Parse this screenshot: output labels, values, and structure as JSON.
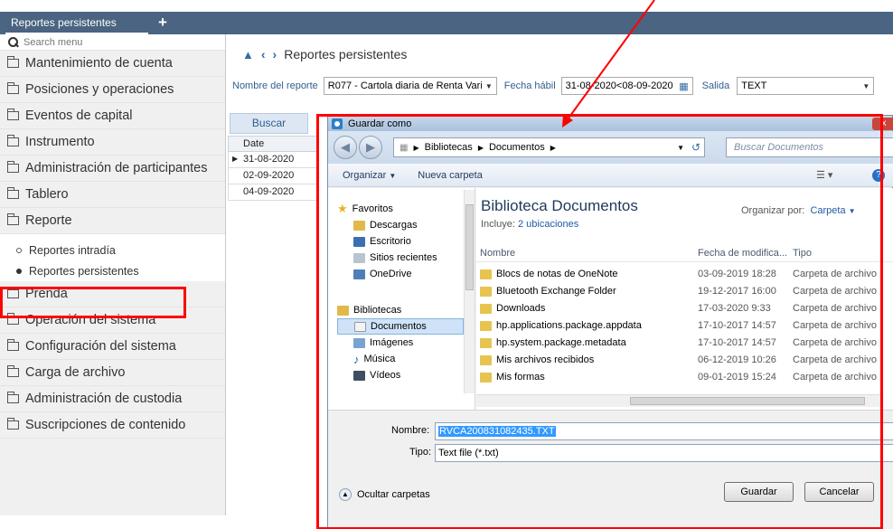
{
  "top_tab": {
    "label": "Reportes persistentes",
    "plus": "+"
  },
  "sidebar": {
    "search_placeholder": "Search menu",
    "items": [
      {
        "label": "Mantenimiento de cuenta"
      },
      {
        "label": "Posiciones y operaciones"
      },
      {
        "label": "Eventos de capital"
      },
      {
        "label": "Instrumento"
      },
      {
        "label": "Administración de participantes"
      },
      {
        "label": "Tablero"
      },
      {
        "label": "Reporte"
      }
    ],
    "sub_items": [
      {
        "label": "Reportes intradía"
      },
      {
        "label": "Reportes persistentes"
      }
    ],
    "items_after": [
      {
        "label": "Prenda"
      },
      {
        "label": "Operación del sistema"
      },
      {
        "label": "Configuración del sistema"
      },
      {
        "label": "Carga de archivo"
      },
      {
        "label": "Administración de custodia"
      },
      {
        "label": "Suscripciones de contenido"
      }
    ]
  },
  "breadcrumb": {
    "title": "Reportes persistentes"
  },
  "form": {
    "report_label": "Nombre del reporte",
    "report_value": "R077 - Cartola diaria de Renta Vari",
    "date_label": "Fecha hábil",
    "date_value": "31-08-2020<08-09-2020",
    "output_label": "Salida",
    "output_value": "TEXT"
  },
  "search_button": "Buscar",
  "grid": {
    "header": "Date",
    "rows": [
      "31-08-2020",
      "02-09-2020",
      "04-09-2020"
    ]
  },
  "dialog": {
    "title": "Guardar como",
    "close": "x",
    "address": [
      "Bibliotecas",
      "Documentos"
    ],
    "search_placeholder": "Buscar Documentos",
    "toolbar": {
      "organize": "Organizar",
      "new_folder": "Nueva carpeta"
    },
    "nav": {
      "favorites": "Favoritos",
      "fav_items": [
        "Descargas",
        "Escritorio",
        "Sitios recientes",
        "OneDrive"
      ],
      "libraries": "Bibliotecas",
      "lib_items": [
        "Documentos",
        "Imágenes",
        "Música",
        "Vídeos"
      ]
    },
    "library_title": "Biblioteca Documentos",
    "library_includes": "Incluye:",
    "library_locations": "2 ubicaciones",
    "arrange_label": "Organizar por:",
    "arrange_value": "Carpeta",
    "columns": {
      "name": "Nombre",
      "date": "Fecha de modifica...",
      "type": "Tipo"
    },
    "files": [
      {
        "name": "Blocs de notas de OneNote",
        "date": "03-09-2019 18:28",
        "type": "Carpeta de archivo"
      },
      {
        "name": "Bluetooth Exchange Folder",
        "date": "19-12-2017 16:00",
        "type": "Carpeta de archivo"
      },
      {
        "name": "Downloads",
        "date": "17-03-2020 9:33",
        "type": "Carpeta de archivo"
      },
      {
        "name": "hp.applications.package.appdata",
        "date": "17-10-2017 14:57",
        "type": "Carpeta de archivo"
      },
      {
        "name": "hp.system.package.metadata",
        "date": "17-10-2017 14:57",
        "type": "Carpeta de archivo"
      },
      {
        "name": "Mis archivos recibidos",
        "date": "06-12-2019 10:26",
        "type": "Carpeta de archivo"
      },
      {
        "name": "Mis formas",
        "date": "09-01-2019 15:24",
        "type": "Carpeta de archivo"
      }
    ],
    "filename_label": "Nombre:",
    "filename_value": "RVCA200831082435.TXT",
    "filetype_label": "Tipo:",
    "filetype_value": "Text file (*.txt)",
    "hide_folders": "Ocultar carpetas",
    "save": "Guardar",
    "cancel": "Cancelar"
  },
  "colors": {
    "topbar": "#4a6481",
    "annotation": "#ff0000",
    "link": "#1f5ba8"
  }
}
